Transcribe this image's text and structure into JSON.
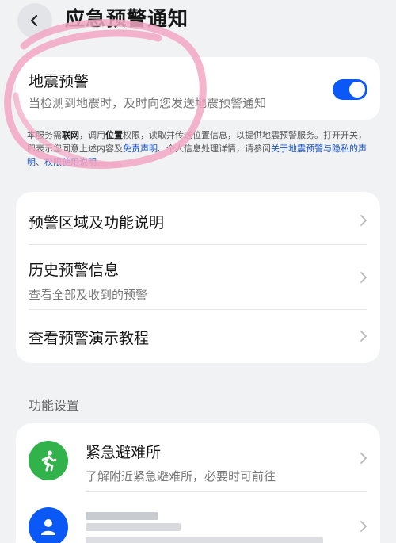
{
  "header": {
    "title": "应急预警通知"
  },
  "earthquake_alert": {
    "title": "地震预警",
    "subtitle": "当检测到地震时，及时向您发送地震预警通知",
    "toggle_on": true
  },
  "notice": {
    "seg1": "本服务需",
    "seg2": "联网",
    "seg3": "，调用",
    "seg4": "位置",
    "seg5": "权限，读取并传送位置信息，以提供地震预警服务。打开开关，即表示您同意上述内容及",
    "link1": "免责声明",
    "seg6": "、个人信息处理详情，请参阅",
    "link2": "关于地震预警与隐私的声明",
    "seg7": "、",
    "link3": "权限使用说明",
    "seg8": "。"
  },
  "list": {
    "items": [
      {
        "label": "预警区域及功能说明"
      },
      {
        "label": "历史预警信息",
        "sub": "查看全部及收到的预警"
      },
      {
        "label": "查看预警演示教程"
      }
    ]
  },
  "settings": {
    "section_label": "功能设置",
    "shelter": {
      "label": "紧急避难所",
      "sub": "了解附近紧急避难所，必要时可前往"
    }
  },
  "colors": {
    "accent": "#0a59f7",
    "shelter_green": "#31b24a",
    "scribble_pink": "#f2a7c3"
  }
}
